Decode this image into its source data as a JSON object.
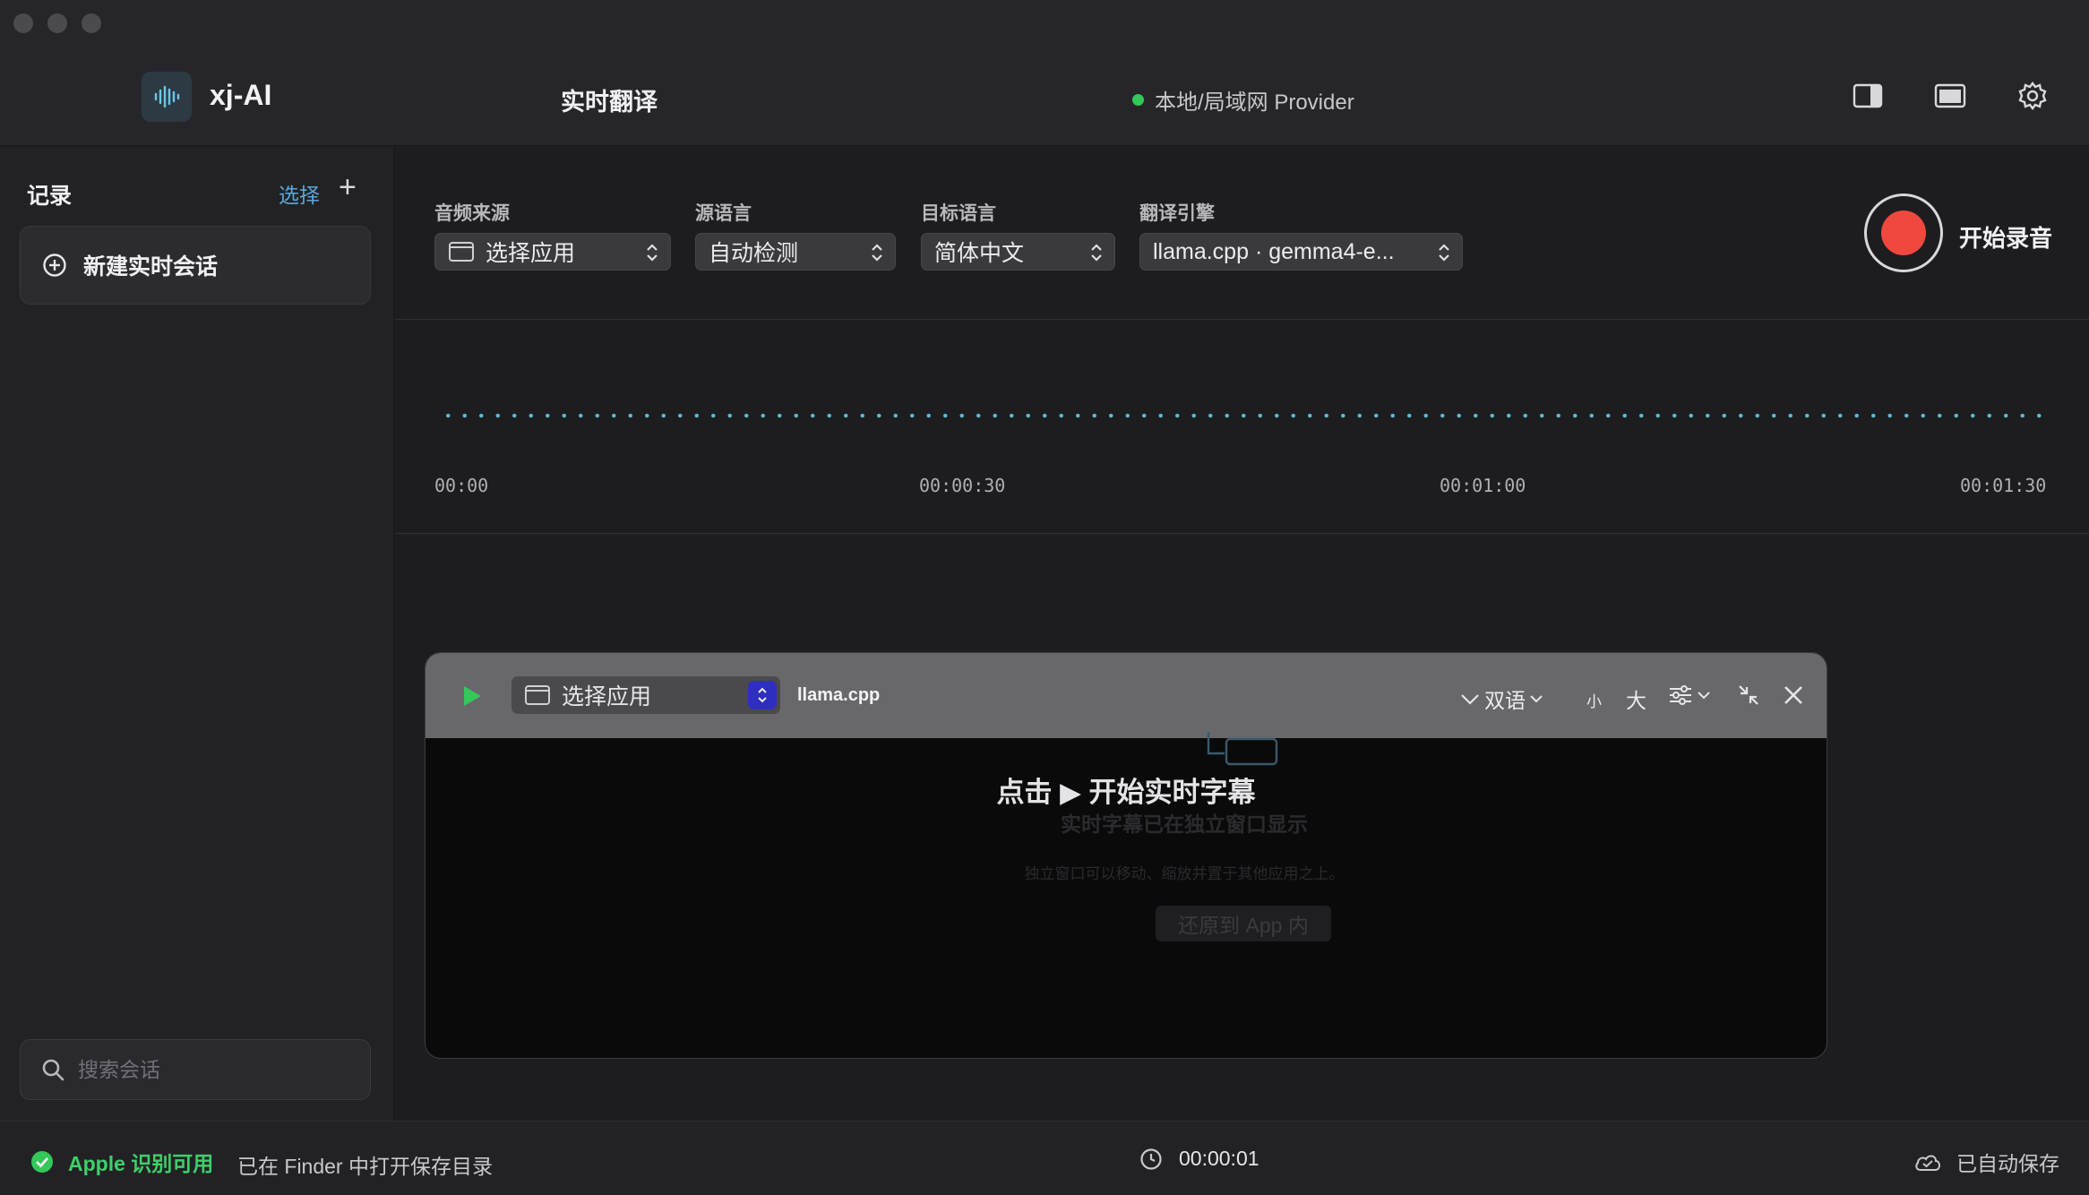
{
  "app": {
    "name": "xj-AI",
    "page_title": "实时翻译"
  },
  "provider": {
    "label": "本地/局域网 Provider",
    "status_color": "#34c759"
  },
  "toolbar_icons": [
    "sidebar-toggle-icon",
    "window-mode-icon",
    "gear-icon"
  ],
  "sidebar": {
    "title": "记录",
    "select_label": "选择",
    "add_label": "+",
    "new_session_label": "新建实时会话",
    "search_placeholder": "搜索会话"
  },
  "controls": {
    "audio_source": {
      "label": "音频来源",
      "value": "选择应用"
    },
    "source_lang": {
      "label": "源语言",
      "value": "自动检测"
    },
    "target_lang": {
      "label": "目标语言",
      "value": "简体中文"
    },
    "engine": {
      "label": "翻译引擎",
      "value": "llama.cpp · gemma4-e..."
    },
    "record_label": "开始录音",
    "record_color": "#f0483e"
  },
  "timeline": {
    "ticks": [
      "00:00",
      "00:00:30",
      "00:01:00",
      "00:01:30"
    ],
    "wave_color": "#5fb8d4"
  },
  "panel": {
    "source_value": "选择应用",
    "engine": "llama.cpp",
    "mode_label": "双语",
    "size_small": "小",
    "size_large": "大",
    "hint_main": "点击 ▶ 开始实时字幕",
    "hint_sub": "实时字幕已在独立窗口显示",
    "hint_small": "独立窗口可以移动、缩放并置于其他应用之上。",
    "restore_label": "还原到 App 内"
  },
  "status": {
    "recognition": "Apple 识别可用",
    "finder": "已在 Finder 中打开保存目录",
    "elapsed": "00:00:01",
    "saved": "已自动保存"
  }
}
